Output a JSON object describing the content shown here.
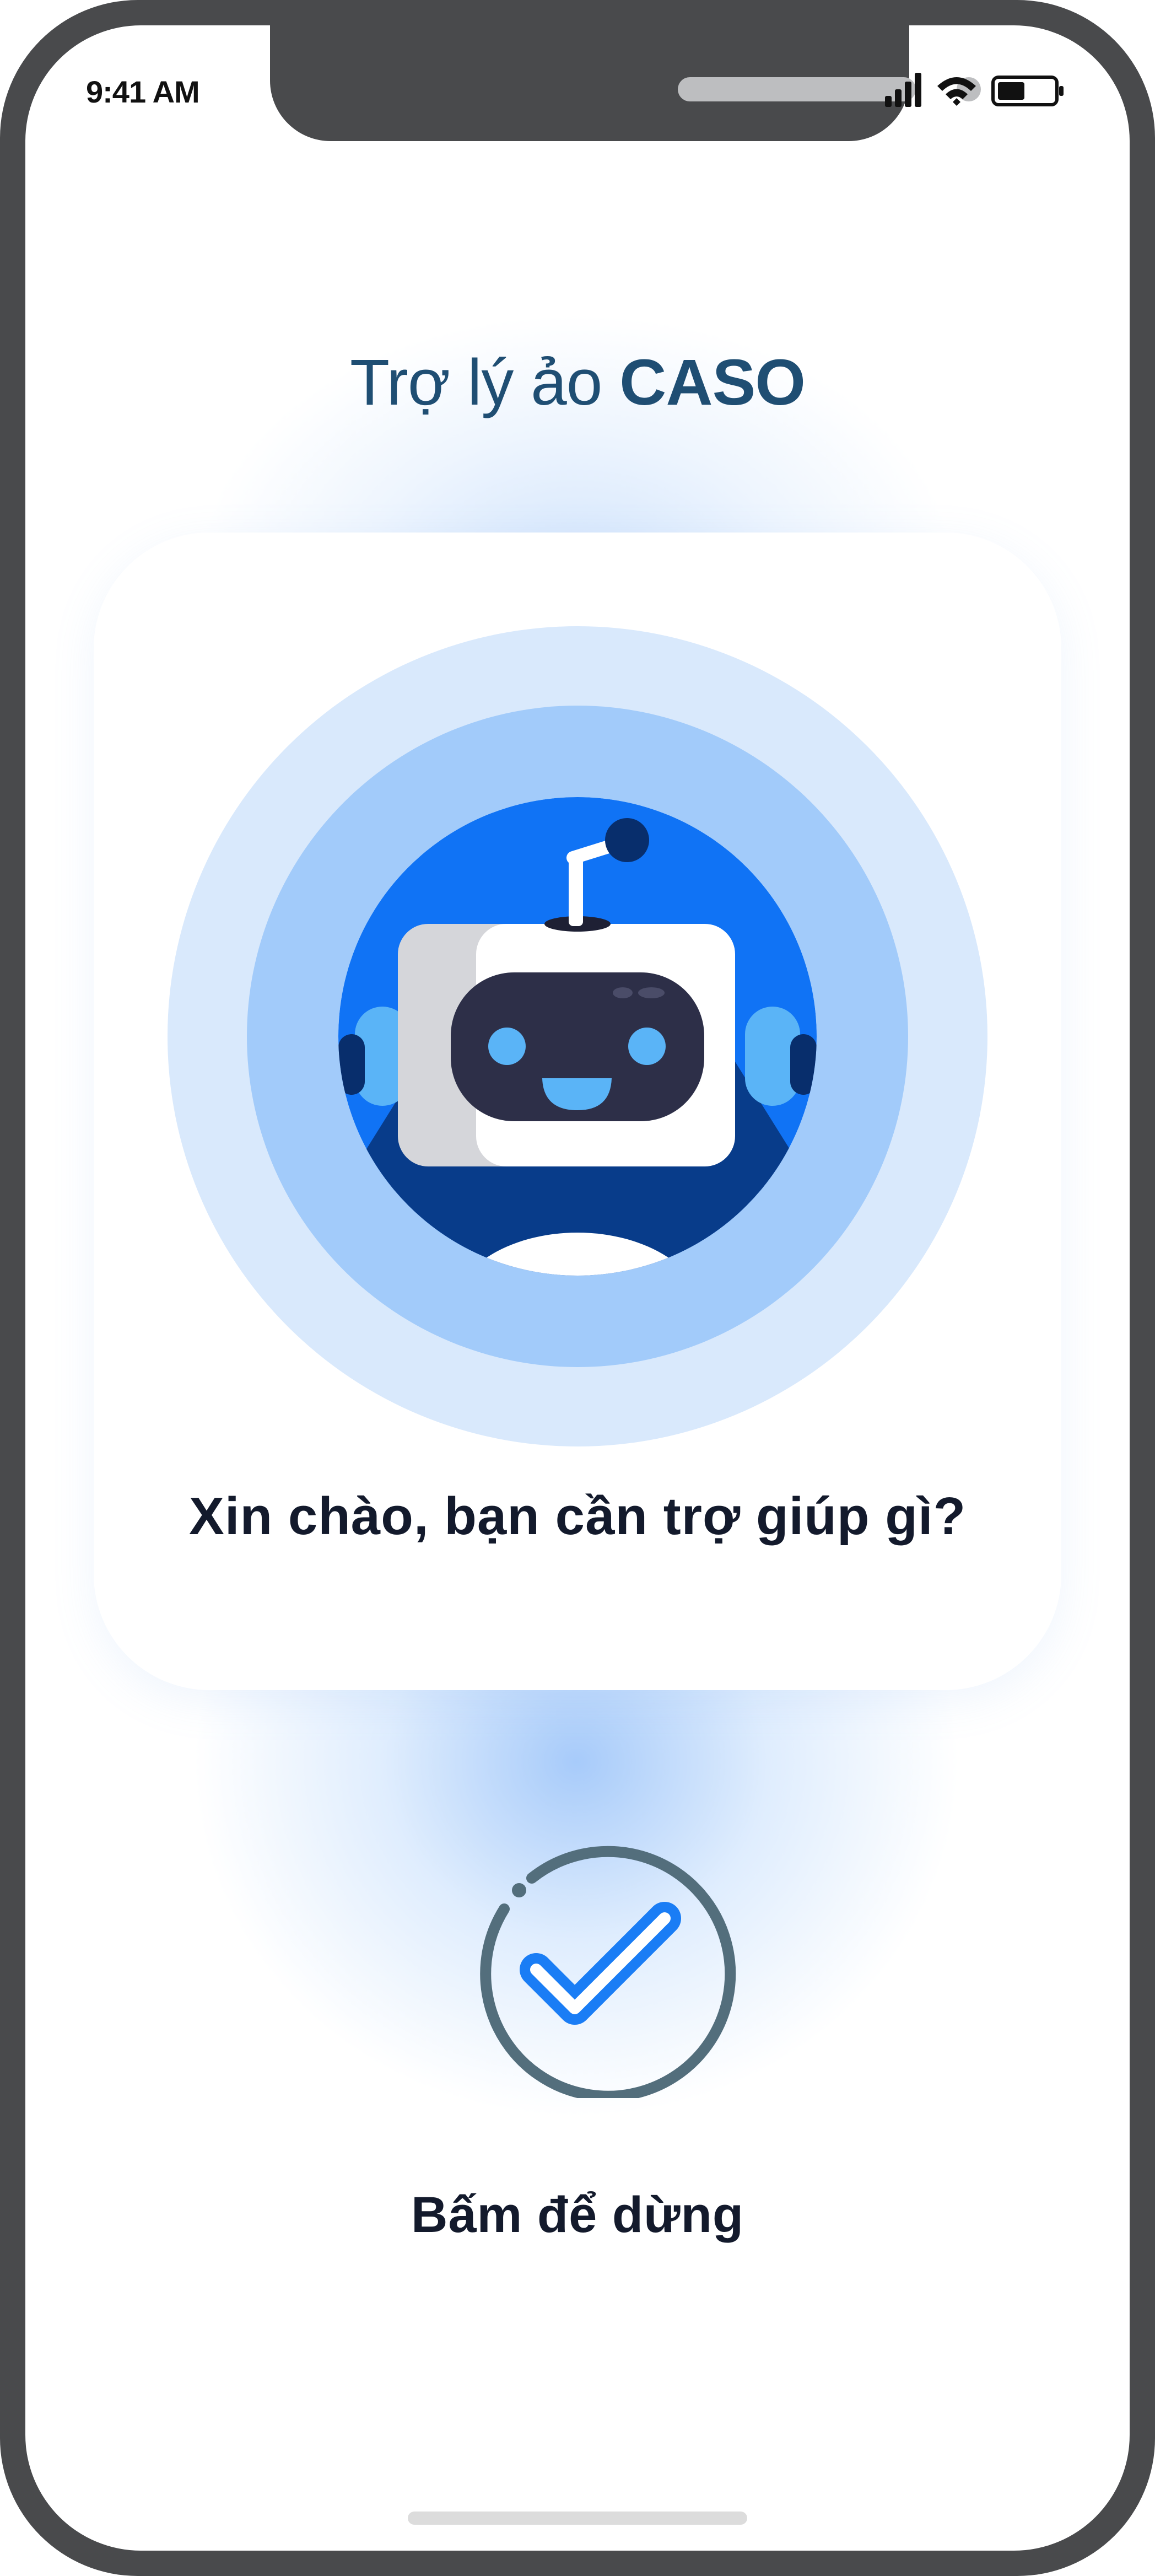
{
  "status_bar": {
    "time": "9:41 AM",
    "icons": [
      "signal-icon",
      "wifi-icon",
      "battery-icon"
    ]
  },
  "header": {
    "title_prefix": "Trợ lý ảo ",
    "title_brand": "CASO"
  },
  "assistant_card": {
    "avatar": "robot-icon",
    "greeting": "Xin chào, bạn cần trợ giúp gì?"
  },
  "stop_control": {
    "icon": "checkmark-icon",
    "label": "Bấm để dừng"
  },
  "colors": {
    "frame": "#494a4c",
    "title": "#1f4e73",
    "text": "#131a2c",
    "ring_outer": "#d9e9fc",
    "ring_middle": "#a2cbfa",
    "robot_background": "#1073f5",
    "check": "#1a7df5",
    "stop_ring": "#536e7c"
  }
}
